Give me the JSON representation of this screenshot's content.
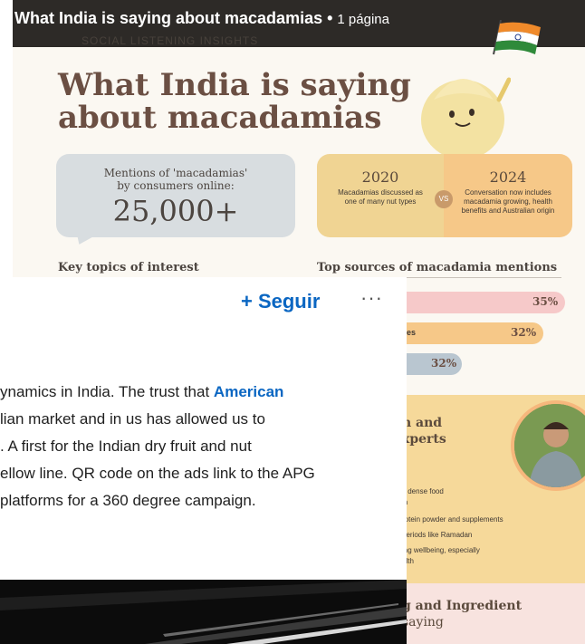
{
  "document": {
    "title": "What India is saying about macadamias",
    "separator": " • ",
    "pages": "1 página"
  },
  "infographic": {
    "kicker": "SOCIAL LISTENING INSIGHTS",
    "headline_line1": "What India is saying",
    "headline_line2": "about macadamias",
    "mentions_label_line1": "Mentions of 'macadamias'",
    "mentions_label_line2": "by consumers online:",
    "mentions_value": "25,000+",
    "compare": {
      "left_year": "2020",
      "left_text_line1": "Macadamias discussed as",
      "left_text_line2": "one of many nut types",
      "vs": "VS",
      "right_year": "2024",
      "right_text_line1": "Conversation now includes",
      "right_text_line2": "macadamia growing, health",
      "right_text_line3": "benefits and Australian origin"
    },
    "topics_heading": "Key topics of interest",
    "sources_heading": "Top sources of macadamia mentions",
    "sources": [
      {
        "label": "",
        "value": "35%",
        "pct": 35
      },
      {
        "label": "tes",
        "value": "32%",
        "pct": 32
      },
      {
        "label": "",
        "value": "32%",
        "pct": 32
      }
    ],
    "panel_orange": {
      "heading_line1": "n and",
      "heading_line2": "xperts",
      "items": [
        "y dense food",
        "in",
        "rotein powder and supplements",
        "periods like Ramadan",
        "ing wellbeing, especially",
        "alth"
      ]
    },
    "panel_pink": {
      "heading_line1": "g and Ingredient",
      "heading_line2": "saying"
    }
  },
  "post": {
    "follow_label": "+ Seguir",
    "more_label": "···",
    "line1_text": "ynamics in India. The trust that ",
    "line1_mention": "American",
    "line2": "lian market and in us has allowed us to",
    "line3": ". A first for the Indian dry fruit and nut",
    "line4": "ellow line. QR code on the ads link to the APG",
    "line5": "platforms for a 360 degree campaign."
  },
  "colors": {
    "accent_blue": "#0a66c2",
    "header_bg": "#2d2a27",
    "headline_brown": "#6b4f43",
    "bar_pink": "#f6c9c9",
    "bar_orange": "#f6c888",
    "bar_blue": "#b9c6d0"
  }
}
